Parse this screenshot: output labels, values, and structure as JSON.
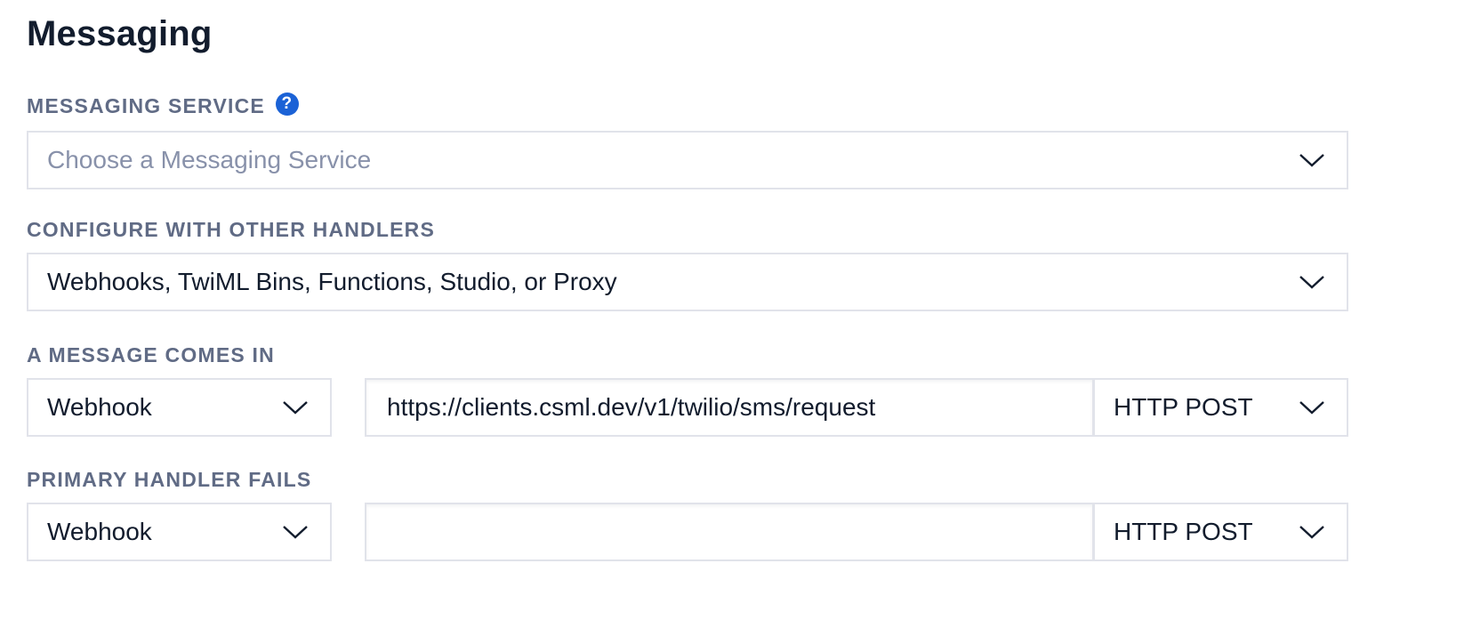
{
  "section": {
    "title": "Messaging"
  },
  "messaging_service": {
    "label": "MESSAGING SERVICE",
    "help_icon": "question-circle-icon",
    "placeholder": "Choose a Messaging Service"
  },
  "other_handlers": {
    "label": "CONFIGURE WITH OTHER HANDLERS",
    "value": "Webhooks, TwiML Bins, Functions, Studio, or Proxy"
  },
  "message_comes_in": {
    "label": "A MESSAGE COMES IN",
    "handler_type": "Webhook",
    "url": "https://clients.csml.dev/v1/twilio/sms/request",
    "method": "HTTP POST"
  },
  "primary_handler_fails": {
    "label": "PRIMARY HANDLER FAILS",
    "handler_type": "Webhook",
    "url": "",
    "method": "HTTP POST"
  },
  "colors": {
    "heading": "#121c2d",
    "label": "#606b85",
    "border": "#e1e3ea",
    "placeholder": "#8891aa",
    "help_icon": "#1b62d6"
  }
}
